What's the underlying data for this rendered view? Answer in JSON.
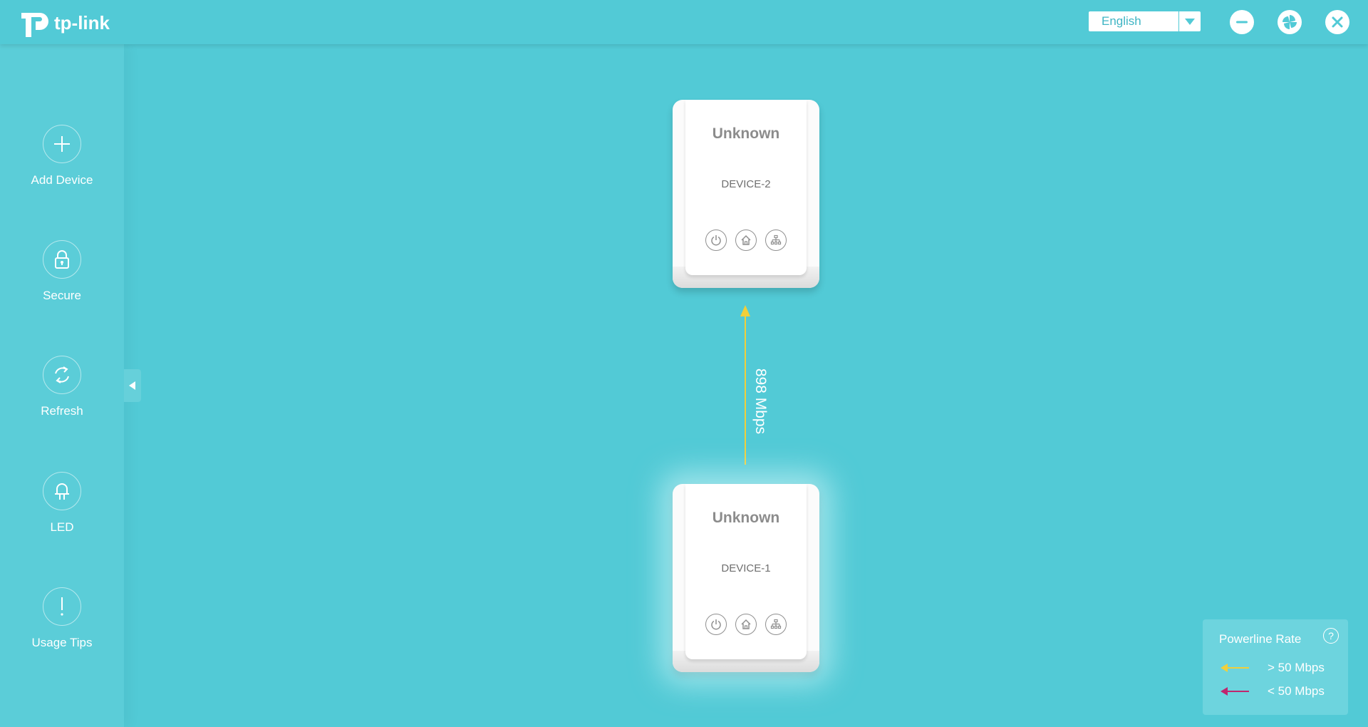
{
  "app": {
    "logo_text": "tp-link"
  },
  "header": {
    "language": "English",
    "buttons": [
      "minimize",
      "settings",
      "close"
    ]
  },
  "sidebar": {
    "items": [
      {
        "label": "Add Device",
        "icon": "plus-icon"
      },
      {
        "label": "Secure",
        "icon": "lock-icon"
      },
      {
        "label": "Refresh",
        "icon": "refresh-icon"
      },
      {
        "label": "LED",
        "icon": "bulb-icon"
      },
      {
        "label": "Usage Tips",
        "icon": "exclamation-icon"
      }
    ]
  },
  "devices": [
    {
      "name": "Unknown",
      "id": "DEVICE-2"
    },
    {
      "name": "Unknown",
      "id": "DEVICE-1"
    }
  ],
  "link": {
    "rate": "898 Mbps",
    "color": "#f1cf3b"
  },
  "legend": {
    "title": "Powerline Rate",
    "items": [
      {
        "label": "> 50 Mbps",
        "color": "#f1cf3b"
      },
      {
        "label": "< 50 Mbps",
        "color": "#c0266e"
      }
    ]
  }
}
